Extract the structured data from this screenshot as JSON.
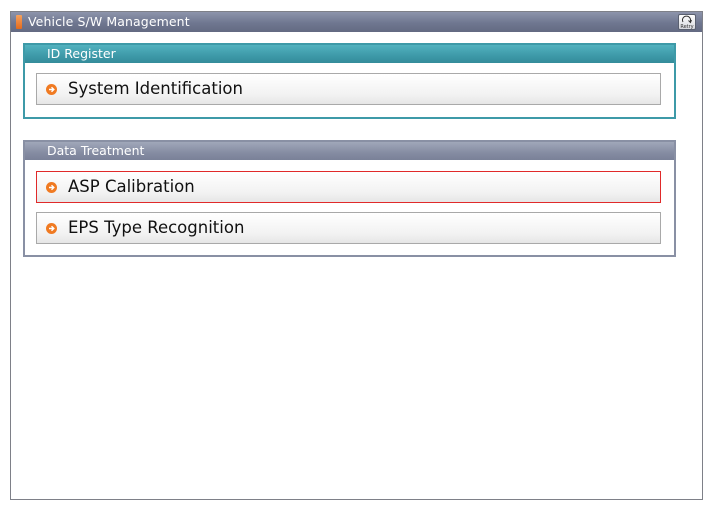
{
  "window": {
    "title": "Vehicle S/W Management",
    "retry_label": "Retry"
  },
  "panels": [
    {
      "header": "ID Register",
      "items": [
        {
          "label": "System Identification",
          "selected": false
        }
      ]
    },
    {
      "header": "Data Treatment",
      "items": [
        {
          "label": "ASP Calibration",
          "selected": true
        },
        {
          "label": "EPS Type Recognition",
          "selected": false
        }
      ]
    }
  ],
  "colors": {
    "titlebar": "#6f7790",
    "id_panel_accent": "#3e9aa8",
    "data_panel_accent": "#858ca2",
    "selection_border": "#e02a2a",
    "bullet": "#f07a22"
  },
  "icons": {
    "title_marker": "orange-bar-icon",
    "retry": "retry-icon",
    "bullet": "orange-arrow-bullet-icon"
  }
}
